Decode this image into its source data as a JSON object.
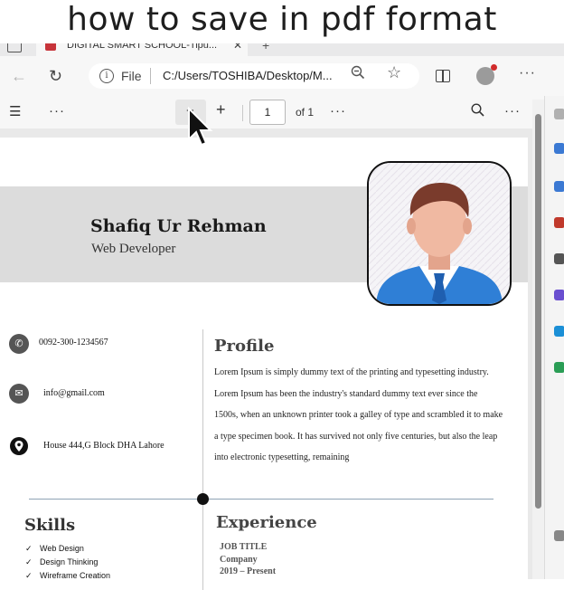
{
  "caption": "how to save in pdf format",
  "browser": {
    "tab_title": "DIGITAL SMART SCHOOL-Tipu...",
    "file_label": "File",
    "url": "C:/Users/TOSHIBA/Desktop/M..."
  },
  "pdf_toolbar": {
    "page_number": "1",
    "page_total": "of 1"
  },
  "resume": {
    "name": "Shafiq Ur Rehman",
    "role": "Web Developer",
    "contacts": [
      {
        "icon": "phone-icon",
        "text": "0092-300-1234567"
      },
      {
        "icon": "mail-icon",
        "text": "info@gmail.com"
      },
      {
        "icon": "location-icon",
        "text": "House 444,G Block DHA Lahore"
      }
    ],
    "profile_heading": "Profile",
    "profile_text": "Lorem Ipsum is simply dummy text of the printing and typesetting industry. Lorem Ipsum has been the industry's standard dummy text ever since the 1500s, when an unknown printer took a galley of type and scrambled it to make a type specimen book. It has survived not only five centuries, but also the leap into electronic typesetting, remaining",
    "skills_heading": "Skills",
    "skills": [
      "Web Design",
      "Design Thinking",
      "Wireframe Creation"
    ],
    "experience_heading": "Experience",
    "experience": {
      "job_title": "JOB TITLE",
      "company": "Company",
      "dates": "2019 – Present"
    }
  },
  "colors": {
    "name_band": "#dcdcdc",
    "timeline_line": "#8fa3b5",
    "shirt": "#2f7fd6"
  }
}
